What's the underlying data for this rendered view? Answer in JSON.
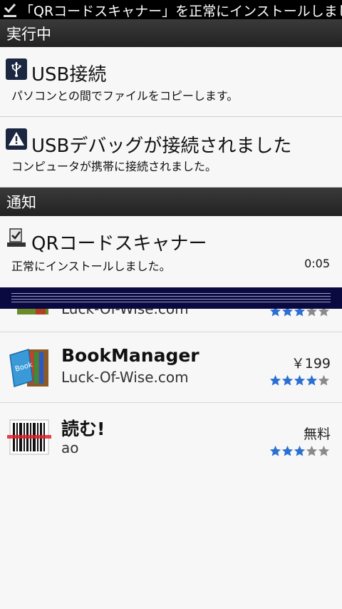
{
  "statusbar": {
    "ticker_text": "「QRコードスキャナー」を正常にインストールしまし",
    "icon": "download-complete-icon"
  },
  "sections": {
    "ongoing": "実行中",
    "notifications": "通知"
  },
  "ongoing_items": [
    {
      "title": "USB接続",
      "description": "パソコンとの間でファイルをコピーします。",
      "icon": "usb-icon"
    },
    {
      "title": "USBデバッグが接続されました",
      "description": "コンピュータが携帯に接続されました。",
      "icon": "warning-icon"
    }
  ],
  "notification_items": [
    {
      "title": "QRコードスキャナー",
      "description": "正常にインストールしました。",
      "time": "0:05",
      "icon": "install-complete-icon"
    }
  ],
  "apps": [
    {
      "name": "",
      "developer": "Luck-Of-Wise.com",
      "price": "",
      "rating": 3
    },
    {
      "name": "BookManager",
      "developer": "Luck-Of-Wise.com",
      "price": "￥199",
      "rating": 4
    },
    {
      "name": "読む!",
      "developer": "ao",
      "price": "無料",
      "rating": 3
    }
  ],
  "colors": {
    "star_filled": "#2a6fd1",
    "star_empty": "#8a8a8a",
    "header_bg": "#2b2b2b",
    "handle_bg": "#0a0a40"
  }
}
